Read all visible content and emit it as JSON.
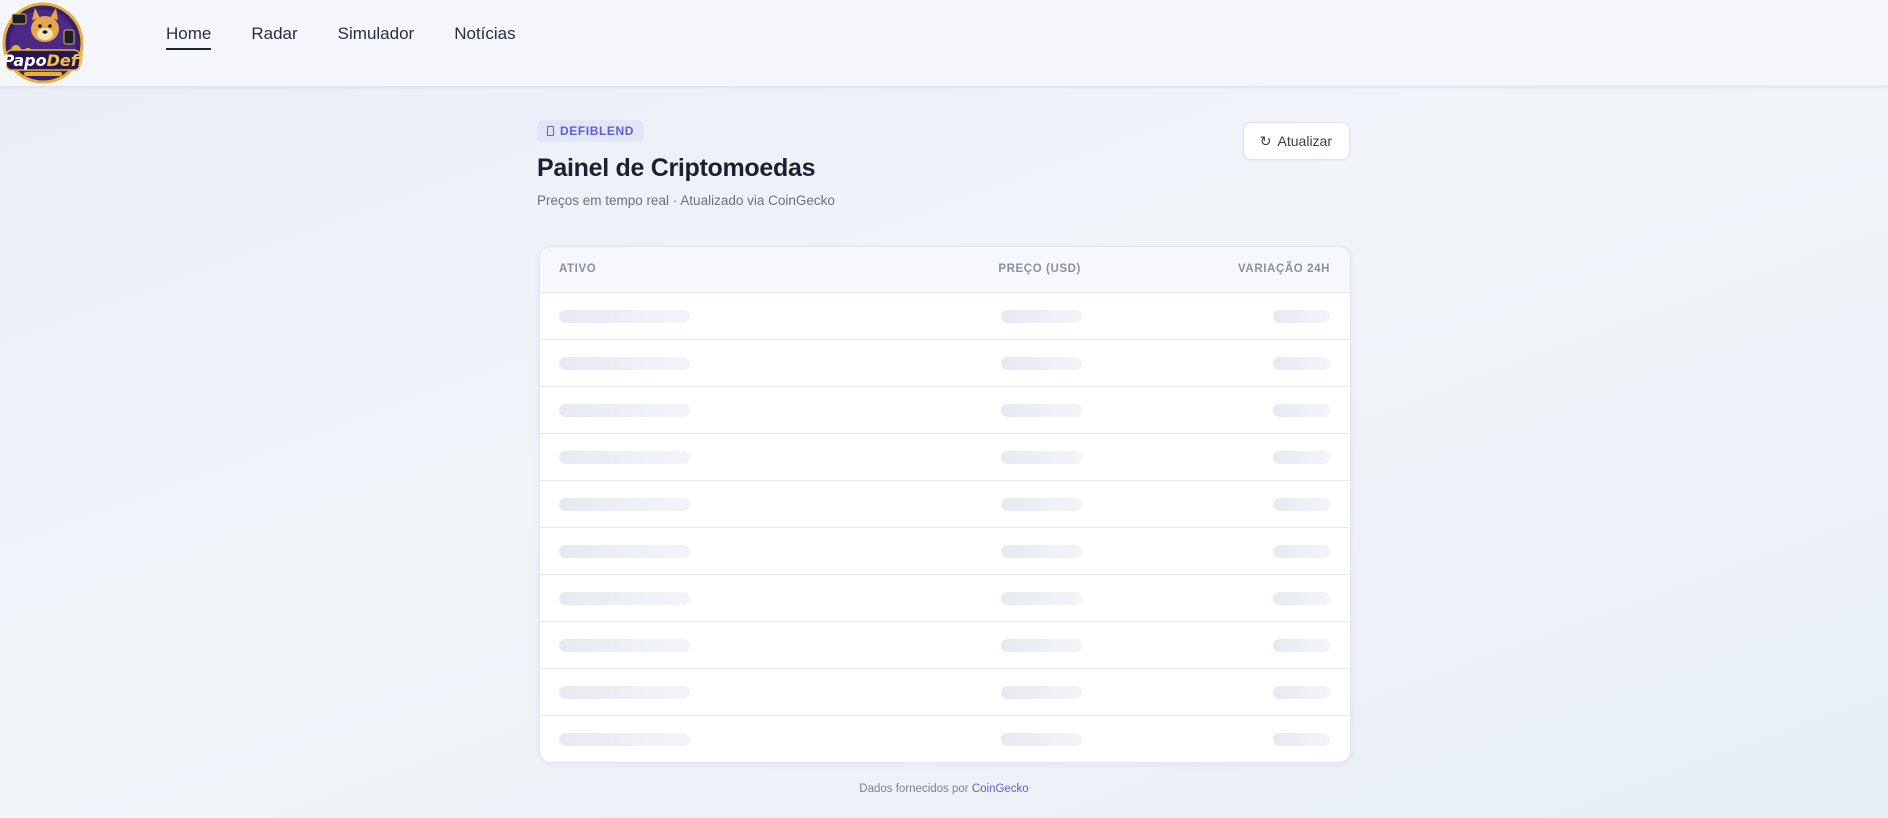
{
  "brand": {
    "logo_text": "PapoDefi"
  },
  "nav": {
    "items": [
      {
        "label": "Home",
        "active": true
      },
      {
        "label": "Radar",
        "active": false
      },
      {
        "label": "Simulador",
        "active": false
      },
      {
        "label": "Notícias",
        "active": false
      }
    ]
  },
  "header": {
    "badge": "DEFIBLEND",
    "title": "Painel de Criptomoedas",
    "subtitle": "Preços em tempo real · Atualizado via CoinGecko",
    "refresh_label": "Atualizar",
    "refresh_icon": "↻"
  },
  "table": {
    "columns": [
      "ATIVO",
      "PREÇO (USD)",
      "VARIAÇÃO 24H"
    ],
    "rows_loading": 10
  },
  "footer": {
    "text": "Dados fornecidos por",
    "link": "CoinGecko"
  },
  "colors": {
    "accent": "#5b5fd6",
    "text": "#1b2030",
    "muted": "#6a7080"
  }
}
